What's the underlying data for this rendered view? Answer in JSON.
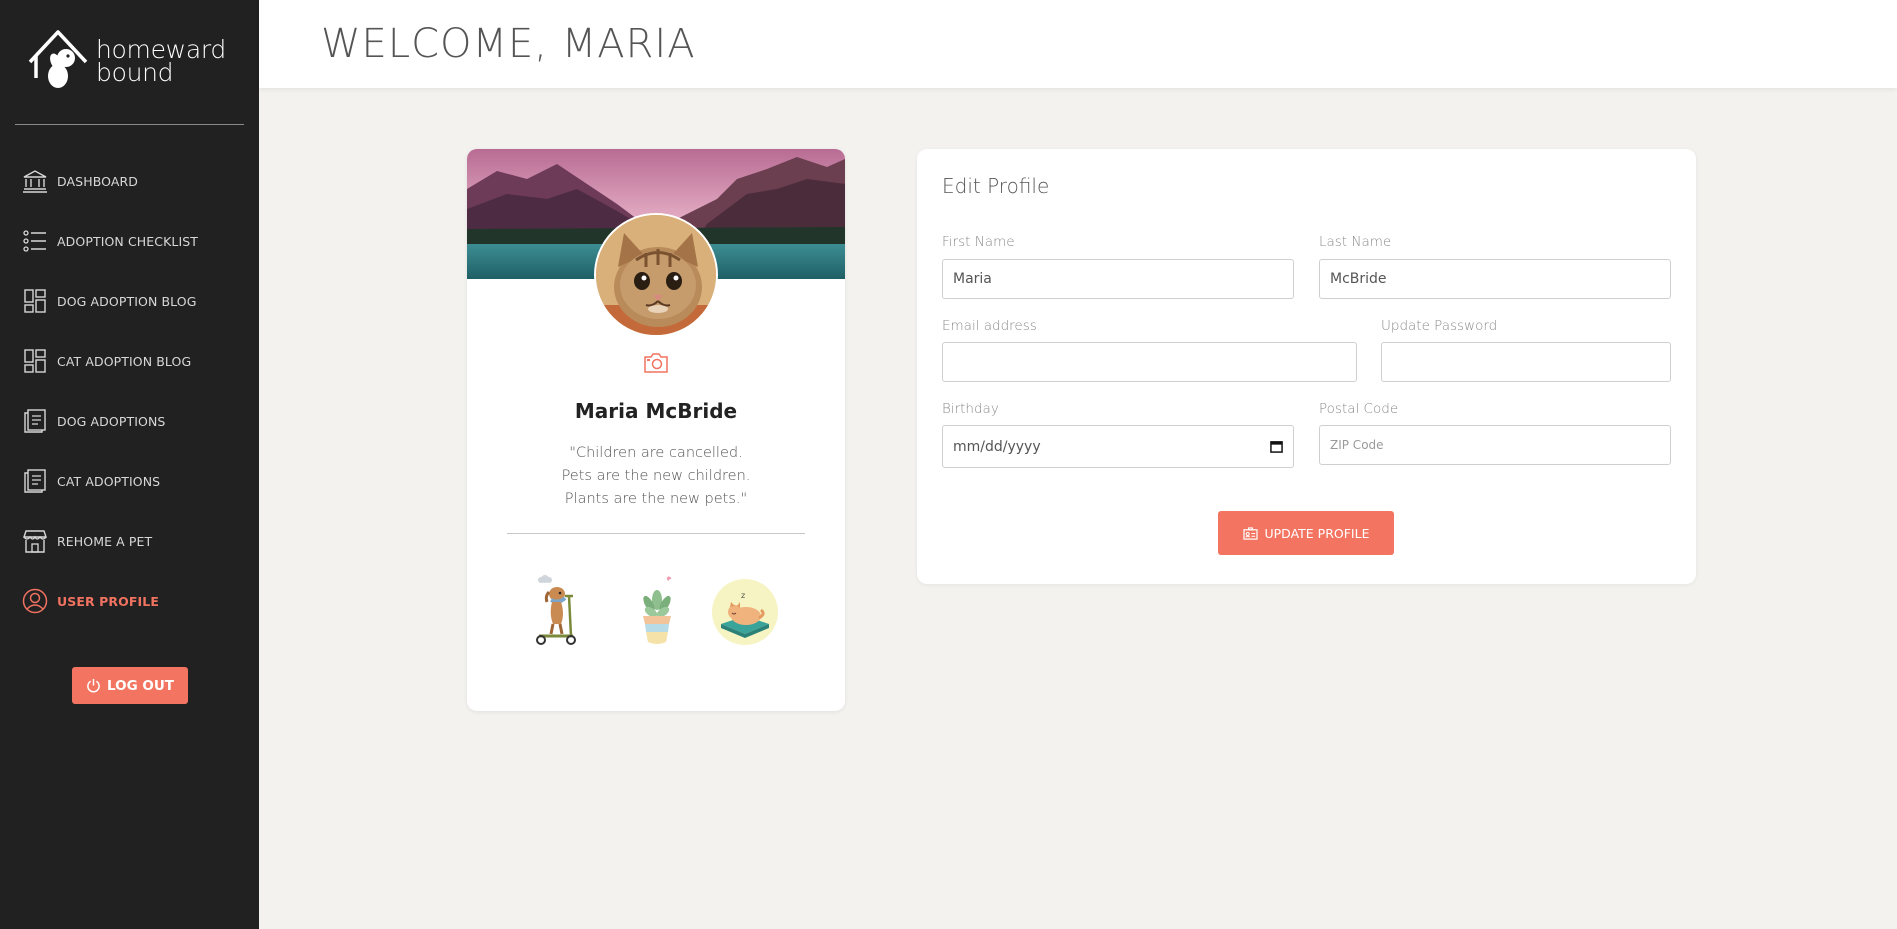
{
  "brand": {
    "line1": "homeward",
    "line2": "bound"
  },
  "sidebar": {
    "items": [
      {
        "label": "DASHBOARD",
        "icon": "bank-icon"
      },
      {
        "label": "ADOPTION CHECKLIST",
        "icon": "checklist-icon"
      },
      {
        "label": "DOG ADOPTION BLOG",
        "icon": "dashboard-layout-icon"
      },
      {
        "label": "CAT ADOPTION BLOG",
        "icon": "dashboard-layout-icon"
      },
      {
        "label": "DOG ADOPTIONS",
        "icon": "document-icon"
      },
      {
        "label": "CAT ADOPTIONS",
        "icon": "document-icon"
      },
      {
        "label": "REHOME A PET",
        "icon": "storefront-icon"
      },
      {
        "label": "USER PROFILE",
        "icon": "user-circle-icon",
        "active": true
      }
    ],
    "logout_label": "LOG OUT"
  },
  "header": {
    "title": "WELCOME, MARIA"
  },
  "profile": {
    "name": "Maria McBride",
    "quote_lines": [
      "\"Children are cancelled.",
      "Pets are the new children.",
      "Plants are the new pets.\""
    ]
  },
  "edit_profile": {
    "title": "Edit Profile",
    "first_name": {
      "label": "First Name",
      "value": "Maria"
    },
    "last_name": {
      "label": "Last Name",
      "value": "McBride"
    },
    "email": {
      "label": "Email address",
      "value": ""
    },
    "password": {
      "label": "Update Password",
      "value": ""
    },
    "birthday": {
      "label": "Birthday",
      "placeholder": "mm/dd/yyyy"
    },
    "postal_code": {
      "label": "Postal Code",
      "placeholder": "ZIP Code"
    },
    "submit_label": "UPDATE PROFILE"
  },
  "colors": {
    "accent": "#f37561",
    "sidebar_bg": "#212121",
    "page_bg": "#f3f2ef"
  }
}
